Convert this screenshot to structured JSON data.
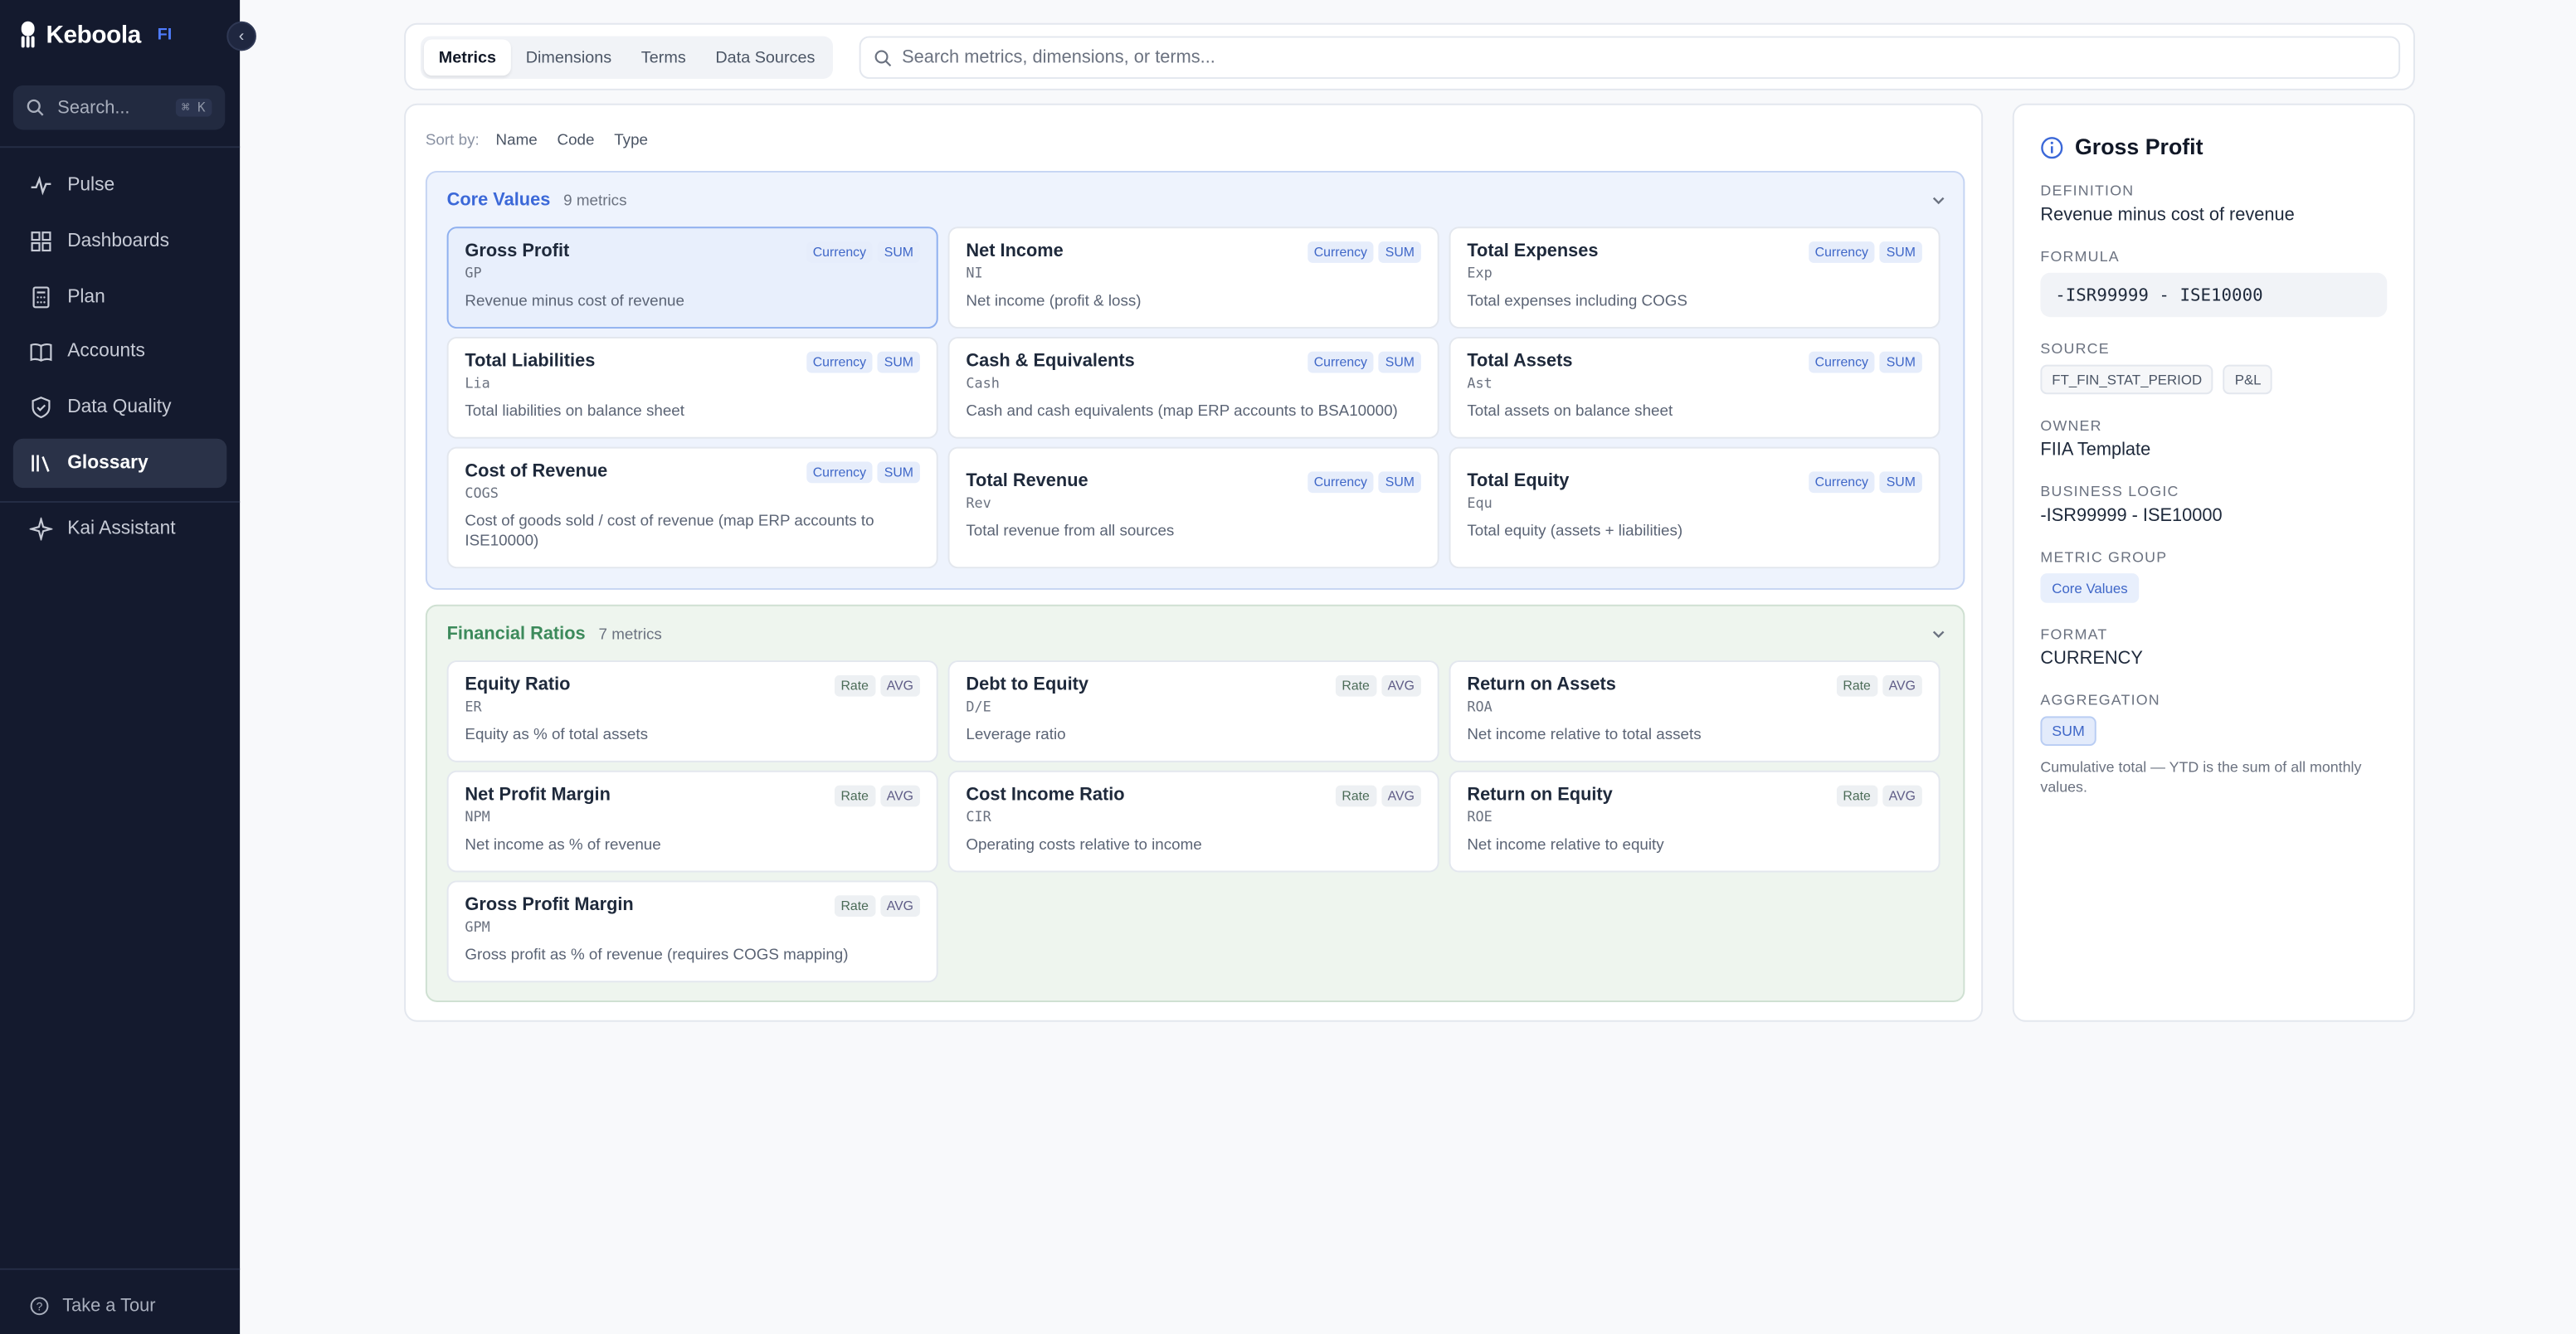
{
  "brand": {
    "name": "Keboola",
    "tag": "FI"
  },
  "sidebar": {
    "search_placeholder": "Search...",
    "search_shortcut": "⌘ K",
    "items": [
      {
        "label": "Pulse",
        "icon": "pulse-icon"
      },
      {
        "label": "Dashboards",
        "icon": "dashboard-grid-icon"
      },
      {
        "label": "Plan",
        "icon": "calculator-icon"
      },
      {
        "label": "Accounts",
        "icon": "book-open-icon"
      },
      {
        "label": "Data Quality",
        "icon": "shield-check-icon"
      },
      {
        "label": "Glossary",
        "icon": "library-icon",
        "active": true
      },
      {
        "label": "Kai Assistant",
        "icon": "sparkle-icon"
      }
    ],
    "tour_label": "Take a Tour"
  },
  "topbar": {
    "tabs": [
      "Metrics",
      "Dimensions",
      "Terms",
      "Data Sources"
    ],
    "active_tab": "Metrics",
    "search_placeholder": "Search metrics, dimensions, or terms..."
  },
  "sort": {
    "label": "Sort by:",
    "options": [
      "Name",
      "Code",
      "Type"
    ]
  },
  "groups": [
    {
      "title": "Core Values",
      "count": "9 metrics",
      "color": "#3b68d8",
      "metrics": [
        {
          "name": "Gross Profit",
          "code": "GP",
          "desc": "Revenue minus cost of revenue",
          "badges": [
            "Currency",
            "SUM"
          ],
          "selected": true
        },
        {
          "name": "Net Income",
          "code": "NI",
          "desc": "Net income (profit & loss)",
          "badges": [
            "Currency",
            "SUM"
          ]
        },
        {
          "name": "Total Expenses",
          "code": "Exp",
          "desc": "Total expenses including COGS",
          "badges": [
            "Currency",
            "SUM"
          ]
        },
        {
          "name": "Total Liabilities",
          "code": "Lia",
          "desc": "Total liabilities on balance sheet",
          "badges": [
            "Currency",
            "SUM"
          ]
        },
        {
          "name": "Cash & Equivalents",
          "code": "Cash",
          "desc": "Cash and cash equivalents (map ERP accounts to BSA10000)",
          "badges": [
            "Currency",
            "SUM"
          ]
        },
        {
          "name": "Total Assets",
          "code": "Ast",
          "desc": "Total assets on balance sheet",
          "badges": [
            "Currency",
            "SUM"
          ]
        },
        {
          "name": "Cost of Revenue",
          "code": "COGS",
          "desc": "Cost of goods sold / cost of revenue (map ERP accounts to ISE10000)",
          "badges": [
            "Currency",
            "SUM"
          ]
        },
        {
          "name": "Total Revenue",
          "code": "Rev",
          "desc": "Total revenue from all sources",
          "badges": [
            "Currency",
            "SUM"
          ]
        },
        {
          "name": "Total Equity",
          "code": "Equ",
          "desc": "Total equity (assets + liabilities)",
          "badges": [
            "Currency",
            "SUM"
          ]
        }
      ]
    },
    {
      "title": "Financial Ratios",
      "count": "7 metrics",
      "color": "#3c8a5b",
      "metrics": [
        {
          "name": "Equity Ratio",
          "code": "ER",
          "desc": "Equity as % of total assets",
          "badges": [
            "Rate",
            "AVG"
          ]
        },
        {
          "name": "Debt to Equity",
          "code": "D/E",
          "desc": "Leverage ratio",
          "badges": [
            "Rate",
            "AVG"
          ]
        },
        {
          "name": "Return on Assets",
          "code": "ROA",
          "desc": "Net income relative to total assets",
          "badges": [
            "Rate",
            "AVG"
          ]
        },
        {
          "name": "Net Profit Margin",
          "code": "NPM",
          "desc": "Net income as % of revenue",
          "badges": [
            "Rate",
            "AVG"
          ]
        },
        {
          "name": "Cost Income Ratio",
          "code": "CIR",
          "desc": "Operating costs relative to income",
          "badges": [
            "Rate",
            "AVG"
          ]
        },
        {
          "name": "Return on Equity",
          "code": "ROE",
          "desc": "Net income relative to equity",
          "badges": [
            "Rate",
            "AVG"
          ]
        },
        {
          "name": "Gross Profit Margin",
          "code": "GPM",
          "desc": "Gross profit as % of revenue (requires COGS mapping)",
          "badges": [
            "Rate",
            "AVG"
          ]
        }
      ]
    }
  ],
  "detail": {
    "title": "Gross Profit",
    "definition_label": "DEFINITION",
    "definition": "Revenue minus cost of revenue",
    "formula_label": "FORMULA",
    "formula": "-ISR99999 - ISE10000",
    "source_label": "SOURCE",
    "sources": [
      "FT_FIN_STAT_PERIOD",
      "P&L"
    ],
    "owner_label": "OWNER",
    "owner": "FIIA Template",
    "logic_label": "BUSINESS LOGIC",
    "logic": "-ISR99999 - ISE10000",
    "group_label": "METRIC GROUP",
    "group": "Core Values",
    "format_label": "FORMAT",
    "format": "CURRENCY",
    "aggregation_label": "AGGREGATION",
    "aggregation": "SUM",
    "aggregation_note": "Cumulative total — YTD is the sum of all monthly values."
  }
}
